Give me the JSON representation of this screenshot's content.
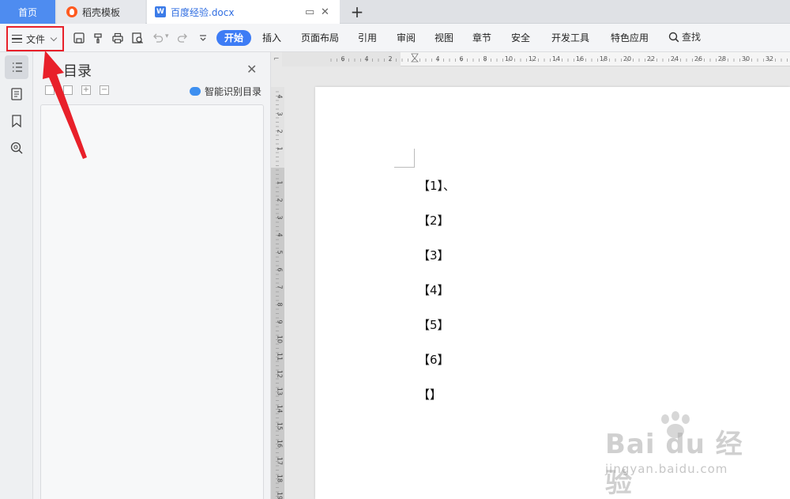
{
  "tabs": {
    "home": "首页",
    "templates": "稻壳模板",
    "document": "百度经验.docx"
  },
  "toolbar": {
    "file": "文件",
    "start": "开始",
    "menu": [
      "插入",
      "页面布局",
      "引用",
      "审阅",
      "视图",
      "章节",
      "安全",
      "开发工具",
      "特色应用"
    ],
    "search": "查找"
  },
  "nav": {
    "title": "目录",
    "smart_toc": "智能识别目录"
  },
  "ruler": {
    "horizontal": [
      "6",
      "4",
      "2",
      "2",
      "4",
      "6",
      "8",
      "10",
      "12",
      "14",
      "16",
      "18",
      "20",
      "22",
      "24",
      "26",
      "28",
      "30",
      "32"
    ],
    "vertical_top": [
      "4",
      "3",
      "2",
      "1"
    ],
    "vertical": [
      "1",
      "2",
      "3",
      "4",
      "5",
      "6",
      "7",
      "8",
      "9",
      "10",
      "11",
      "12",
      "13",
      "14",
      "15",
      "16",
      "17",
      "18",
      "19"
    ]
  },
  "document": {
    "lines": [
      "【1】、",
      "【2】",
      "【3】",
      "【4】",
      "【5】",
      "【6】",
      "【】"
    ]
  },
  "watermark": {
    "brand": "Bai du 经验",
    "sub": "jingyan.baidu.com"
  },
  "colors": {
    "accent": "#3d7cf5",
    "home_tab": "#4e8cf0",
    "highlight_red": "#e8202a"
  }
}
